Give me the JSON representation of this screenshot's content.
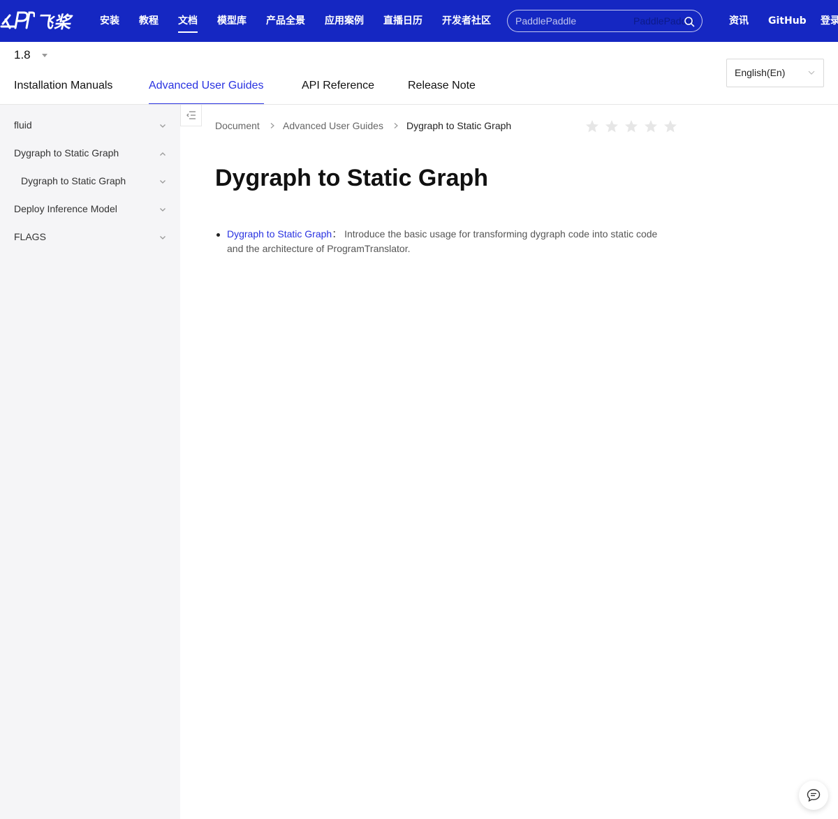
{
  "topnav": {
    "logo_text": "飞桨",
    "links": [
      {
        "label": "安装",
        "active": false
      },
      {
        "label": "教程",
        "active": false
      },
      {
        "label": "文档",
        "active": true
      },
      {
        "label": "模型库",
        "active": false
      },
      {
        "label": "产品全景",
        "active": false
      },
      {
        "label": "应用案例",
        "active": false
      },
      {
        "label": "直播日历",
        "active": false
      },
      {
        "label": "开发者社区",
        "active": false
      }
    ],
    "search": {
      "placeholder": "PaddlePaddle",
      "ghost_text": "PaddlePaddle"
    },
    "right_links": [
      {
        "label": "资讯"
      },
      {
        "label": "GitHub"
      },
      {
        "label": "登录"
      }
    ],
    "background_color": "#1527c2"
  },
  "header": {
    "version": "1.8",
    "tabs": [
      {
        "label": "Installation Manuals",
        "active": false
      },
      {
        "label": "Advanced User Guides",
        "active": true
      },
      {
        "label": "API Reference",
        "active": false
      },
      {
        "label": "Release Note",
        "active": false
      }
    ],
    "language": "English(En)"
  },
  "sidebar": {
    "items": [
      {
        "label": "fluid",
        "expanded": false,
        "level": 1
      },
      {
        "label": "Dygraph to Static Graph",
        "expanded": true,
        "level": 1
      },
      {
        "label": "Dygraph to Static Graph",
        "expanded": false,
        "level": 2
      },
      {
        "label": "Deploy Inference Model",
        "expanded": false,
        "level": 1
      },
      {
        "label": "FLAGS",
        "expanded": false,
        "level": 1
      }
    ]
  },
  "breadcrumb": {
    "items": [
      "Document",
      "Advanced User Guides",
      "Dygraph to Static Graph"
    ]
  },
  "rating": {
    "max": 5,
    "value": 0
  },
  "main": {
    "title": "Dygraph to Static Graph",
    "list": [
      {
        "link": "Dygraph to Static Graph",
        "separator": "：",
        "text": "Introduce the basic usage for transforming dygraph code into static code and the architecture of ProgramTranslator."
      }
    ]
  },
  "accent_color": "#2932e1"
}
